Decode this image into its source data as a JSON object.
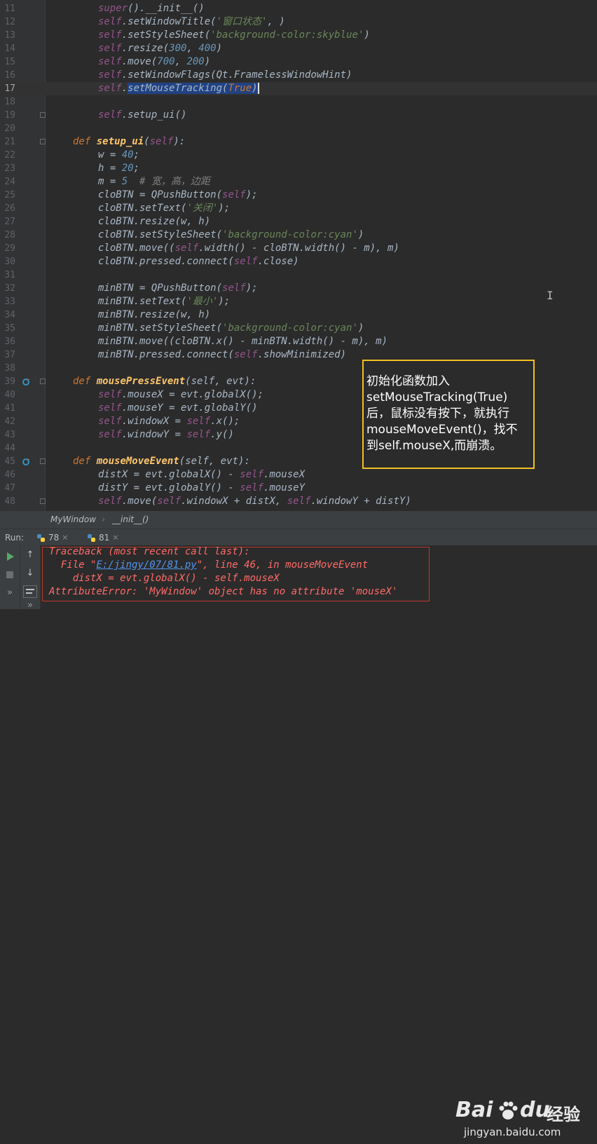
{
  "editor": {
    "lines": [
      {
        "n": "11"
      },
      {
        "n": "12"
      },
      {
        "n": "13"
      },
      {
        "n": "14"
      },
      {
        "n": "15"
      },
      {
        "n": "16"
      },
      {
        "n": "17"
      },
      {
        "n": "18"
      },
      {
        "n": "19"
      },
      {
        "n": "20"
      },
      {
        "n": "21"
      },
      {
        "n": "22"
      },
      {
        "n": "23"
      },
      {
        "n": "24"
      },
      {
        "n": "25"
      },
      {
        "n": "26"
      },
      {
        "n": "27"
      },
      {
        "n": "28"
      },
      {
        "n": "29"
      },
      {
        "n": "30"
      },
      {
        "n": "31"
      },
      {
        "n": "32"
      },
      {
        "n": "33"
      },
      {
        "n": "34"
      },
      {
        "n": "35"
      },
      {
        "n": "36"
      },
      {
        "n": "37"
      },
      {
        "n": "38"
      },
      {
        "n": "39"
      },
      {
        "n": "40"
      },
      {
        "n": "41"
      },
      {
        "n": "42"
      },
      {
        "n": "43"
      },
      {
        "n": "44"
      },
      {
        "n": "45"
      },
      {
        "n": "46"
      },
      {
        "n": "47"
      },
      {
        "n": "48"
      }
    ],
    "t": {
      "super": "super",
      "init_call": "().__init__()",
      "self": "self",
      "setWindowTitle": ".setWindowTitle(",
      "title_str": "'窗口状态'",
      "title_end": ", )",
      "setStyleSheet": ".setStyleSheet(",
      "skyblue": "'background-color:skyblue'",
      "close_paren": ")",
      "resize": ".resize(",
      "n300": "300",
      "comma": ", ",
      "n400": "400",
      "move": ".move(",
      "n700": "700",
      "n200": "200",
      "setWindowFlags": ".setWindowFlags(Qt.FramelessWindowHint)",
      "setMouseTracking": "setMouseTracking(",
      "true_kw": "True",
      "setup_call": ".setup_ui()",
      "def": "def",
      "setup_ui": "setup_ui",
      "self_param_open": "(",
      "self_param_close": "):",
      "w_eq": "w = ",
      "n40": "40",
      "semi": ";",
      "h_eq": "h = ",
      "n20": "20",
      "m_eq": "m = ",
      "n5": "5",
      "comment": "  # 宽，高，边距",
      "clo_eq": "cloBTN = QPushButton(",
      "paren_semi": ");",
      "clo_settext": "cloBTN.setText(",
      "guanbi": "'关闭'",
      "clo_resize": "cloBTN.resize(w, h)",
      "clo_ss": "cloBTN.setStyleSheet(",
      "cyan": "'background-color:cyan'",
      "clo_move_a": "cloBTN.move((",
      "clo_move_b": ".width() - cloBTN.width() - m), m)",
      "clo_pressed_a": "cloBTN.pressed.connect(",
      "close_attr": ".close)",
      "min_eq": "minBTN = QPushButton(",
      "min_settext": "minBTN.setText(",
      "zuixiao": "'最小'",
      "min_resize": "minBTN.resize(w, h)",
      "min_ss": "minBTN.setStyleSheet(",
      "min_move": "minBTN.move((cloBTN.x() - minBTN.width() - m), m)",
      "min_pressed_a": "minBTN.pressed.connect(",
      "showmin": ".showMinimized)",
      "mousePressEvent": "mousePressEvent",
      "evt_params": "(self, evt):",
      "mouseX_a": ".mouseX = evt.globalX();",
      "mouseY_a": ".mouseY = evt.globalY()",
      "windowX_a": ".windowX = ",
      "x_call": ".x();",
      "windowY_a": ".windowY = ",
      "y_call": ".y()",
      "mouseMoveEvent": "mouseMoveEvent",
      "distX_a": "distX = evt.globalX() - ",
      "mouseX_attr": ".mouseX",
      "distY_a": "distY = evt.globalY() - ",
      "move_a": ".move(",
      "windowX_b": ".windowX + distX, ",
      "windowY_b": ".windowY + distY)"
    }
  },
  "annotation": {
    "lines": [
      "初始化函数加入",
      "setMouseTracking(True)",
      "后，鼠标没有按下，就执行",
      "mouseMoveEvent()，找不",
      "到self.mouseX,而崩溃。"
    ]
  },
  "breadcrumb": {
    "class_name": "MyWindow",
    "separator": "›",
    "method": "__init__()"
  },
  "run_panel": {
    "label": "Run:",
    "tabs": [
      {
        "label": "78",
        "close": "×"
      },
      {
        "label": "81",
        "close": "×"
      }
    ],
    "output": {
      "line1": "Traceback (most recent call last):",
      "line2_a": "  File \"",
      "line2_link": "E:/jingy/07/81.py",
      "line2_b": "\", line 46, in mouseMoveEvent",
      "line3": "    distX = evt.globalX() - self.mouseX",
      "line4": "AttributeError: 'MyWindow' object has no attribute 'mouseX'"
    }
  },
  "watermark": {
    "brand": "Bai",
    "brand_b": "du",
    "cn": "经验",
    "url": "jingyan.baidu.com"
  },
  "colors": {
    "keyword": "#cc7832",
    "self": "#94558d",
    "string": "#6a8759",
    "number": "#6897bb",
    "error": "#ff6b68",
    "annotation_border": "#f0c020"
  }
}
